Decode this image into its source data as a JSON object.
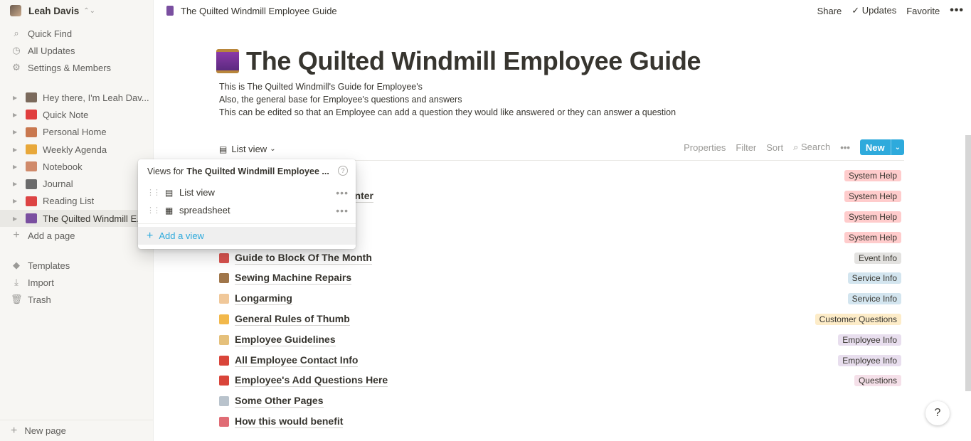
{
  "sidebar": {
    "workspace": "Leah Davis",
    "nav": [
      {
        "label": "Quick Find",
        "icon": "search-icon"
      },
      {
        "label": "All Updates",
        "icon": "clock-icon"
      },
      {
        "label": "Settings & Members",
        "icon": "gear-icon"
      }
    ],
    "pages": [
      {
        "label": "Hey there, I'm Leah Dav...",
        "color": "#7b6a5c"
      },
      {
        "label": "Quick Note",
        "color": "#e03e3e"
      },
      {
        "label": "Personal Home",
        "color": "#c9784f"
      },
      {
        "label": "Weekly Agenda",
        "color": "#e8a83a"
      },
      {
        "label": "Notebook",
        "color": "#d08a6a"
      },
      {
        "label": "Journal",
        "color": "#6b6b6b"
      },
      {
        "label": "Reading List",
        "color": "#d44"
      },
      {
        "label": "The Quilted Windmill E...",
        "color": "#7a4fa0"
      }
    ],
    "add_page": "Add a page",
    "tools": [
      {
        "label": "Templates",
        "icon": "shapes-icon"
      },
      {
        "label": "Import",
        "icon": "download-icon"
      },
      {
        "label": "Trash",
        "icon": "trash-icon"
      }
    ],
    "new_page": "New page"
  },
  "topbar": {
    "breadcrumb": "The Quilted Windmill Employee Guide",
    "share": "Share",
    "updates": "Updates",
    "favorite": "Favorite"
  },
  "page": {
    "title": "The Quilted Windmill Employee Guide",
    "description": [
      "This is The Quilted Windmill's Guide for Employee's",
      "Also, the general base for Employee's questions and answers",
      "This can be edited so that an Employee can add a question they would like answered or they can answer a question"
    ]
  },
  "database": {
    "view_label": "List view",
    "tools": {
      "properties": "Properties",
      "filter": "Filter",
      "sort": "Sort",
      "search": "Search"
    },
    "new_label": "New",
    "rows": [
      {
        "name": "",
        "tag": "System Help",
        "tag_bg": "#ffcccc",
        "tag_fg": "#37352f",
        "color": ""
      },
      {
        "name": "unter",
        "tag": "System Help",
        "tag_bg": "#ffcccc",
        "tag_fg": "#37352f",
        "color": ""
      },
      {
        "name": "",
        "tag": "System Help",
        "tag_bg": "#ffcccc",
        "tag_fg": "#37352f",
        "color": ""
      },
      {
        "name": "",
        "tag": "System Help",
        "tag_bg": "#ffcccc",
        "tag_fg": "#37352f",
        "color": ""
      },
      {
        "name": "Guide to Block Of The Month",
        "tag": "Event Info",
        "tag_bg": "#e3e2e0",
        "tag_fg": "#37352f",
        "color": "#d9534f"
      },
      {
        "name": "Sewing Machine Repairs",
        "tag": "Service Info",
        "tag_bg": "#d3e5ef",
        "tag_fg": "#37352f",
        "color": "#a0764a"
      },
      {
        "name": "Longarming",
        "tag": "Service Info",
        "tag_bg": "#d3e5ef",
        "tag_fg": "#37352f",
        "color": "#f0c89a"
      },
      {
        "name": "General Rules of Thumb",
        "tag": "Customer Questions",
        "tag_bg": "#fdecc8",
        "tag_fg": "#37352f",
        "color": "#f2b84b"
      },
      {
        "name": "Employee Guidelines",
        "tag": "Employee Info",
        "tag_bg": "#e8deee",
        "tag_fg": "#37352f",
        "color": "#e5c07b"
      },
      {
        "name": "All Employee Contact Info",
        "tag": "Employee Info",
        "tag_bg": "#e8deee",
        "tag_fg": "#37352f",
        "color": "#d9453a"
      },
      {
        "name": "Employee's Add Questions Here",
        "tag": "Questions",
        "tag_bg": "#f5e0e9",
        "tag_fg": "#37352f",
        "color": "#d9453a"
      },
      {
        "name": "Some Other Pages",
        "tag": "",
        "tag_bg": "",
        "tag_fg": "",
        "color": "#b9c3cc"
      },
      {
        "name": "How this would benefit",
        "tag": "",
        "tag_bg": "",
        "tag_fg": "",
        "color": "#e06c75"
      }
    ]
  },
  "popup": {
    "prefix": "Views for",
    "db_name": "The Quilted Windmill Employee ...",
    "views": [
      {
        "label": "List view",
        "icon": "list-icon"
      },
      {
        "label": "spreadsheet",
        "icon": "table-icon"
      }
    ],
    "add_view": "Add a view"
  },
  "help": "?"
}
